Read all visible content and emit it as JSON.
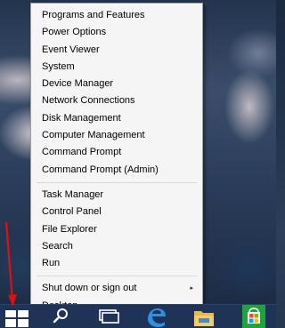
{
  "context_menu": {
    "group1": [
      {
        "label": "Programs and Features"
      },
      {
        "label": "Power Options"
      },
      {
        "label": "Event Viewer"
      },
      {
        "label": "System"
      },
      {
        "label": "Device Manager"
      },
      {
        "label": "Network Connections"
      },
      {
        "label": "Disk Management"
      },
      {
        "label": "Computer Management"
      },
      {
        "label": "Command Prompt"
      },
      {
        "label": "Command Prompt (Admin)"
      }
    ],
    "group2": [
      {
        "label": "Task Manager"
      },
      {
        "label": "Control Panel"
      },
      {
        "label": "File Explorer"
      },
      {
        "label": "Search"
      },
      {
        "label": "Run"
      }
    ],
    "group3": [
      {
        "label": "Shut down or sign out",
        "submenu_arrow": "▸"
      },
      {
        "label": "Desktop"
      }
    ]
  },
  "taskbar": {
    "icons": [
      "windows-start-icon",
      "search-icon",
      "task-view-icon",
      "edge-icon",
      "file-explorer-icon",
      "store-icon"
    ]
  },
  "colors": {
    "menu_bg": "#f5f5f5",
    "taskbar_bg": "#1e3356",
    "annotation_arrow": "#e01010",
    "store_green": "#1fa33b"
  }
}
